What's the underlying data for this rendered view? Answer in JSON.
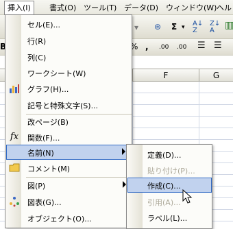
{
  "menubar": {
    "items": [
      {
        "label": "挿入(I)",
        "active": true
      },
      {
        "label": "書式(O)"
      },
      {
        "label": "ツール(T)"
      },
      {
        "label": "データ(D)"
      },
      {
        "label": "ウィンドウ(W)"
      },
      {
        "label": "ヘル"
      }
    ]
  },
  "toolbar": {
    "sigma": "Σ",
    "percent": "%",
    "comma": ",",
    "inc_decimal": ".00",
    "dec_decimal": ".00",
    "bold": "B"
  },
  "columns": [
    "F",
    "G"
  ],
  "insert_menu": {
    "items": [
      {
        "label": "セル(E)..."
      },
      {
        "label": "行(R)"
      },
      {
        "label": "列(C)"
      },
      {
        "label": "ワークシート(W)"
      },
      {
        "label": "グラフ(H)...",
        "icon": "chart-icon"
      },
      {
        "label": "記号と特殊文字(S)..."
      },
      {
        "label": "改ページ(B)"
      },
      {
        "label": "関数(F)...",
        "icon": "function-icon",
        "icon_text": "fx"
      },
      {
        "label": "名前(N)",
        "submenu": true,
        "highlighted": true
      },
      {
        "label": "コメント(M)",
        "icon": "comment-icon"
      },
      {
        "label": "図(P)",
        "submenu": true
      },
      {
        "label": "図表(G)...",
        "icon": "diagram-icon"
      },
      {
        "label": "オブジェクト(O)..."
      }
    ]
  },
  "name_submenu": {
    "items": [
      {
        "label": "定義(D)..."
      },
      {
        "label": "貼り付け(P)...",
        "disabled": true
      },
      {
        "label": "作成(C)...",
        "highlighted": true
      },
      {
        "label": "引用(A)...",
        "disabled": true
      },
      {
        "label": "ラベル(L)..."
      }
    ]
  },
  "colors": {
    "highlight_fill": "#c1d2ee",
    "highlight_border": "#316ac5",
    "disabled_text": "#aca899"
  }
}
